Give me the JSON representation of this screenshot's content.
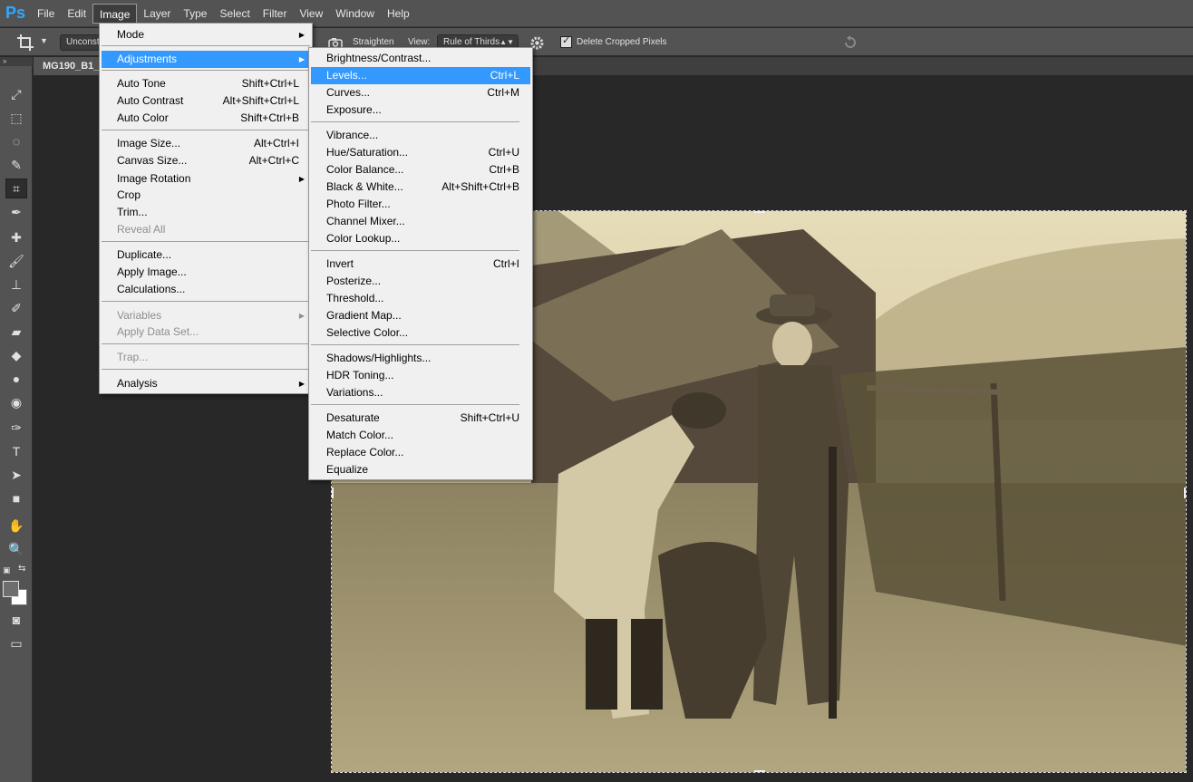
{
  "app": {
    "logo": "Ps"
  },
  "menubar": {
    "items": [
      "File",
      "Edit",
      "Image",
      "Layer",
      "Type",
      "Select",
      "Filter",
      "View",
      "Window",
      "Help"
    ],
    "active": "Image"
  },
  "options": {
    "ratio_value": "Unconstrained",
    "straighten_label": "Straighten",
    "view_label": "View:",
    "view_value": "Rule of Thirds",
    "delete_cropped_label": "Delete Cropped Pixels",
    "delete_cropped_checked": true
  },
  "document": {
    "tab_title": "MG190_B1_"
  },
  "image_menu": {
    "items": [
      {
        "label": "Mode",
        "submenu": true
      },
      {
        "label": "Adjustments",
        "submenu": true,
        "highlighted": true
      },
      {
        "label": "Auto Tone",
        "shortcut": "Shift+Ctrl+L"
      },
      {
        "label": "Auto Contrast",
        "shortcut": "Alt+Shift+Ctrl+L"
      },
      {
        "label": "Auto Color",
        "shortcut": "Shift+Ctrl+B"
      },
      {
        "label": "Image Size...",
        "shortcut": "Alt+Ctrl+I"
      },
      {
        "label": "Canvas Size...",
        "shortcut": "Alt+Ctrl+C"
      },
      {
        "label": "Image Rotation",
        "submenu": true
      },
      {
        "label": "Crop"
      },
      {
        "label": "Trim..."
      },
      {
        "label": "Reveal All",
        "disabled": true
      },
      {
        "label": "Duplicate..."
      },
      {
        "label": "Apply Image..."
      },
      {
        "label": "Calculations..."
      },
      {
        "label": "Variables",
        "submenu": true,
        "disabled": true
      },
      {
        "label": "Apply Data Set...",
        "disabled": true
      },
      {
        "label": "Trap...",
        "disabled": true
      },
      {
        "label": "Analysis",
        "submenu": true
      }
    ]
  },
  "adjustments_menu": {
    "items": [
      {
        "label": "Brightness/Contrast..."
      },
      {
        "label": "Levels...",
        "shortcut": "Ctrl+L",
        "highlighted": true
      },
      {
        "label": "Curves...",
        "shortcut": "Ctrl+M"
      },
      {
        "label": "Exposure..."
      },
      {
        "label": "Vibrance..."
      },
      {
        "label": "Hue/Saturation...",
        "shortcut": "Ctrl+U"
      },
      {
        "label": "Color Balance...",
        "shortcut": "Ctrl+B"
      },
      {
        "label": "Black & White...",
        "shortcut": "Alt+Shift+Ctrl+B"
      },
      {
        "label": "Photo Filter..."
      },
      {
        "label": "Channel Mixer..."
      },
      {
        "label": "Color Lookup..."
      },
      {
        "label": "Invert",
        "shortcut": "Ctrl+I"
      },
      {
        "label": "Posterize..."
      },
      {
        "label": "Threshold..."
      },
      {
        "label": "Gradient Map..."
      },
      {
        "label": "Selective Color..."
      },
      {
        "label": "Shadows/Highlights..."
      },
      {
        "label": "HDR Toning..."
      },
      {
        "label": "Variations..."
      },
      {
        "label": "Desaturate",
        "shortcut": "Shift+Ctrl+U"
      },
      {
        "label": "Match Color..."
      },
      {
        "label": "Replace Color..."
      },
      {
        "label": "Equalize"
      }
    ]
  },
  "tools": [
    {
      "icon": "move-icon",
      "glyph": "⤢"
    },
    {
      "icon": "marquee-icon",
      "glyph": "⬚"
    },
    {
      "icon": "lasso-icon",
      "glyph": "◌"
    },
    {
      "icon": "quick-select-icon",
      "glyph": "✎"
    },
    {
      "icon": "crop-icon",
      "glyph": "⌗",
      "active": true
    },
    {
      "icon": "eyedropper-icon",
      "glyph": "✒"
    },
    {
      "icon": "healing-icon",
      "glyph": "✚"
    },
    {
      "icon": "brush-icon",
      "glyph": "🖌"
    },
    {
      "icon": "stamp-icon",
      "glyph": "⊥"
    },
    {
      "icon": "history-brush-icon",
      "glyph": "✐"
    },
    {
      "icon": "eraser-icon",
      "glyph": "▰"
    },
    {
      "icon": "paint-bucket-icon",
      "glyph": "◆"
    },
    {
      "icon": "blur-icon",
      "glyph": "●"
    },
    {
      "icon": "dodge-icon",
      "glyph": "◉"
    },
    {
      "icon": "pen-icon",
      "glyph": "✑"
    },
    {
      "icon": "type-icon",
      "glyph": "T"
    },
    {
      "icon": "path-select-icon",
      "glyph": "➤"
    },
    {
      "icon": "rectangle-icon",
      "glyph": "■"
    },
    {
      "icon": "hand-icon",
      "glyph": "✋"
    },
    {
      "icon": "zoom-icon",
      "glyph": "🔍"
    }
  ],
  "colors": {
    "menu_highlight": "#3399ff",
    "ui_panel": "#535353",
    "canvas_bg": "#282828",
    "photo_sepia": "#b7a97f"
  }
}
